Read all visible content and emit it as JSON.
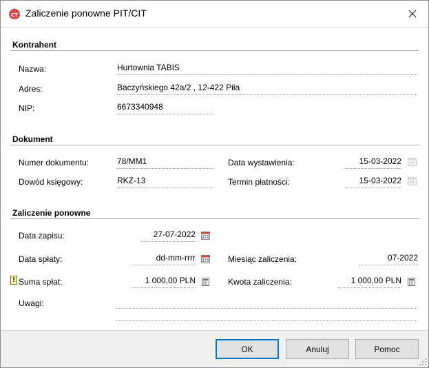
{
  "window": {
    "title": "Zaliczenie ponowne PIT/CIT"
  },
  "kontrahent": {
    "section_title": "Kontrahent",
    "nazwa_label": "Nazwa:",
    "nazwa_value": "Hurtownia TABIS",
    "adres_label": "Adres:",
    "adres_value": "Baczyńskiego  42a/2 , 12-422 Piła",
    "nip_label": "NIP:",
    "nip_value": "6673340948"
  },
  "dokument": {
    "section_title": "Dokument",
    "numer_label": "Numer dokumentu:",
    "numer_value": "78/MM1",
    "dowod_label": "Dowód księgowy:",
    "dowod_value": "RKZ-13",
    "data_wyst_label": "Data wystawienia:",
    "data_wyst_value": "15-03-2022",
    "termin_label": "Termin płatności:",
    "termin_value": "15-03-2022"
  },
  "zaliczenie": {
    "section_title": "Zaliczenie ponowne",
    "data_zapisu_label": "Data zapisu:",
    "data_zapisu_value": "27-07-2022",
    "data_splaty_label": "Data spłaty:",
    "data_splaty_value": "dd-mm-rrrr",
    "miesiac_label": "Miesiąc zaliczenia:",
    "miesiac_value": "07-2022",
    "suma_label": "Suma spłat:",
    "suma_value": "1 000,00 PLN",
    "kwota_label": "Kwota zaliczenia:",
    "kwota_value": "1 000,00 PLN",
    "uwagi_label": "Uwagi:",
    "uwagi_line1": "",
    "uwagi_line2": ""
  },
  "buttons": {
    "ok": "OK",
    "cancel": "Anuluj",
    "help": "Pomoc"
  },
  "colors": {
    "accent": "#0078d7",
    "footer_bg": "#f0f0f0"
  }
}
